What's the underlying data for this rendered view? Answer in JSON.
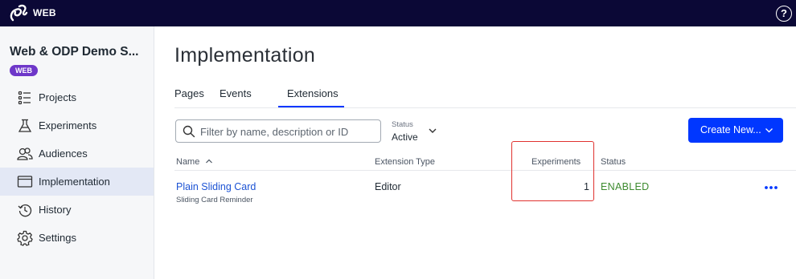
{
  "topbar": {
    "title": "WEB",
    "help_label": "?"
  },
  "sidebar": {
    "project_name": "Web & ODP Demo S...",
    "project_badge": "WEB",
    "items": [
      {
        "label": "Projects",
        "icon": "list-icon"
      },
      {
        "label": "Experiments",
        "icon": "flask-icon"
      },
      {
        "label": "Audiences",
        "icon": "people-icon"
      },
      {
        "label": "Implementation",
        "icon": "window-icon",
        "active": true
      },
      {
        "label": "History",
        "icon": "history-icon"
      },
      {
        "label": "Settings",
        "icon": "gear-icon"
      }
    ]
  },
  "main": {
    "title": "Implementation",
    "tabs": [
      {
        "label": "Pages"
      },
      {
        "label": "Events"
      },
      {
        "label": "Extensions",
        "active": true
      }
    ],
    "search": {
      "placeholder": "Filter by name, description or ID",
      "value": ""
    },
    "status_filter": {
      "caption": "Status",
      "value": "Active"
    },
    "create_button": "Create New...",
    "table": {
      "columns": {
        "name": "Name",
        "type": "Extension Type",
        "experiments": "Experiments",
        "status": "Status"
      },
      "rows": [
        {
          "name": "Plain Sliding Card",
          "description": "Sliding Card Reminder",
          "type": "Editor",
          "experiments": "1",
          "status": "ENABLED"
        }
      ]
    }
  },
  "colors": {
    "topbar": "#0b0836",
    "accent": "#0037ff",
    "badge": "#6e37c9",
    "link": "#1c53d4",
    "enabled": "#3c8a2e",
    "highlight": "#e0322f"
  }
}
